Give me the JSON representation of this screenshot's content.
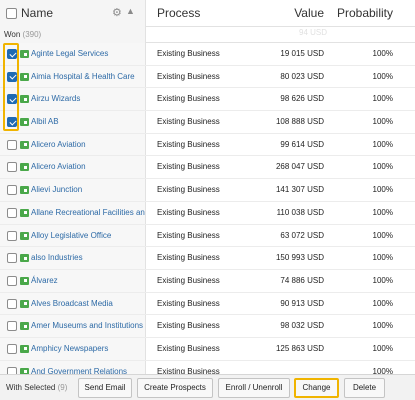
{
  "header": {
    "name_label": "Name",
    "gear_icon": "gear-icon",
    "sort_icon": "sort-asc-icon",
    "process_label": "Process",
    "value_label": "Value",
    "probability_label": "Probability"
  },
  "group": {
    "label": "Won",
    "count": "(390)",
    "ghost": "94 USD"
  },
  "rows": [
    {
      "name": "Aginte Legal Services",
      "process": "Existing Business",
      "value": "19 015 USD",
      "probability": "100%",
      "checked": true
    },
    {
      "name": "Aimia Hospital & Health Care",
      "process": "Existing Business",
      "value": "80 023 USD",
      "probability": "100%",
      "checked": true
    },
    {
      "name": "Airzu Wizards",
      "process": "Existing Business",
      "value": "98 626 USD",
      "probability": "100%",
      "checked": true
    },
    {
      "name": "Albil AB",
      "process": "Existing Business",
      "value": "108 888 USD",
      "probability": "100%",
      "checked": true
    },
    {
      "name": "Alicero Aviation",
      "process": "Existing Business",
      "value": "99 614 USD",
      "probability": "100%",
      "checked": false
    },
    {
      "name": "Alicero Aviation",
      "process": "Existing Business",
      "value": "268 047 USD",
      "probability": "100%",
      "checked": false
    },
    {
      "name": "Alievi Junction",
      "process": "Existing Business",
      "value": "141 307 USD",
      "probability": "100%",
      "checked": false
    },
    {
      "name": "Allane Recreational Facilities and Services",
      "process": "Existing Business",
      "value": "110 038 USD",
      "probability": "100%",
      "checked": false
    },
    {
      "name": "Alloy Legislative Office",
      "process": "Existing Business",
      "value": "63 072 USD",
      "probability": "100%",
      "checked": false
    },
    {
      "name": "also Industries",
      "process": "Existing Business",
      "value": "150 993 USD",
      "probability": "100%",
      "checked": false
    },
    {
      "name": "Álvarez",
      "process": "Existing Business",
      "value": "74 886 USD",
      "probability": "100%",
      "checked": false
    },
    {
      "name": "Alves Broadcast Media",
      "process": "Existing Business",
      "value": "90 913 USD",
      "probability": "100%",
      "checked": false
    },
    {
      "name": "Amer Museums and Institutions",
      "process": "Existing Business",
      "value": "98 032 USD",
      "probability": "100%",
      "checked": false
    },
    {
      "name": "Amphicy Newspapers",
      "process": "Existing Business",
      "value": "125 863 USD",
      "probability": "100%",
      "checked": false
    },
    {
      "name": "And Government Relations",
      "process": "Existing Business",
      "value": "",
      "probability": "100%",
      "checked": false
    }
  ],
  "footer": {
    "label": "With Selected",
    "count": "(9)",
    "buttons": {
      "send_email": "Send Email",
      "create_prospects": "Create Prospects",
      "enroll": "Enroll / Unenroll",
      "change": "Change",
      "delete": "Delete"
    }
  },
  "colors": {
    "link": "#2d6aa6",
    "checkbox_checked": "#1f6ab3",
    "tag_green": "#4aa84a",
    "highlight": "#f0b400"
  }
}
